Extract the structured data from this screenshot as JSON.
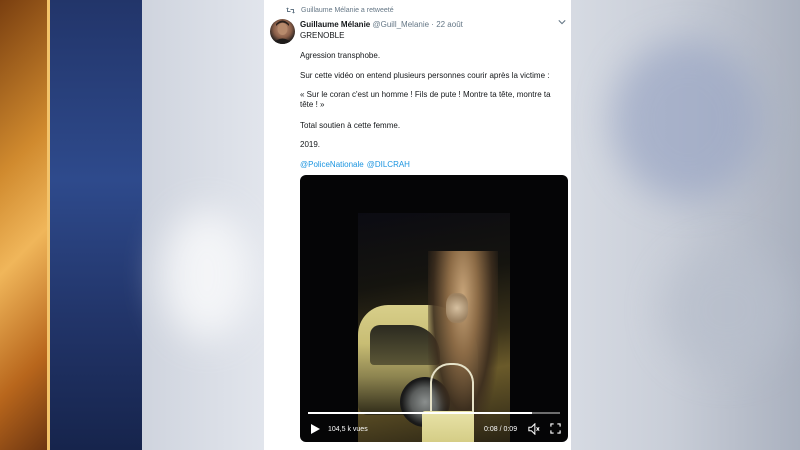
{
  "retweet": {
    "text": "Guillaume Mélanie a retweeté",
    "icon": "retweet-icon"
  },
  "tweet": {
    "author_name": "Guillaume Mélanie",
    "handle": "@Guill_Melanie",
    "separator": " · ",
    "date": "22 août",
    "location": "GRENOBLE",
    "lines": [
      "Agression transphobe.",
      "Sur cette vidéo on entend plusieurs personnes courir après la victime :",
      "« Sur le coran c'est un homme ! Fils de pute ! Montre ta tête, montre ta tête ! »",
      "Total soutien à cette femme.",
      "2019."
    ],
    "mentions": [
      "@PoliceNationale",
      "@DILCRAH"
    ],
    "link_color": "#1b95e0"
  },
  "video": {
    "views": "104,5 k vues",
    "time": "0:08 / 0:09",
    "progress": 0.89
  }
}
